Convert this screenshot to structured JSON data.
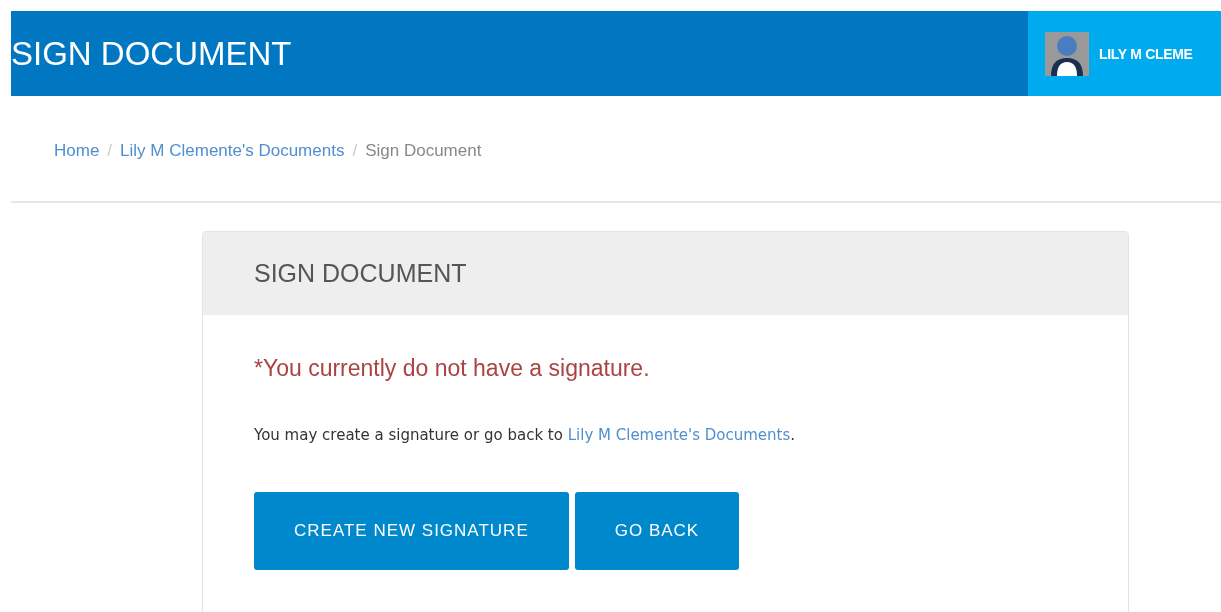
{
  "header": {
    "title": "SIGN DOCUMENT",
    "user": "LILY M CLEME"
  },
  "breadcrumb": [
    {
      "label": "Home",
      "current": false
    },
    {
      "separator": "/",
      "label": "Lily M Clemente's Documents",
      "current": false
    },
    {
      "separator": "/",
      "label": "Sign Document",
      "current": true
    }
  ],
  "panel": {
    "title": "SIGN DOCUMENT",
    "warning": "*You currently do not have a signature.",
    "text_before": "You may create a signature or go back to",
    "link": "Lily M Clemente's Documents",
    "text_after": ".",
    "buttons": [
      "CREATE NEW SIGNATURE",
      "GO BACK"
    ]
  }
}
